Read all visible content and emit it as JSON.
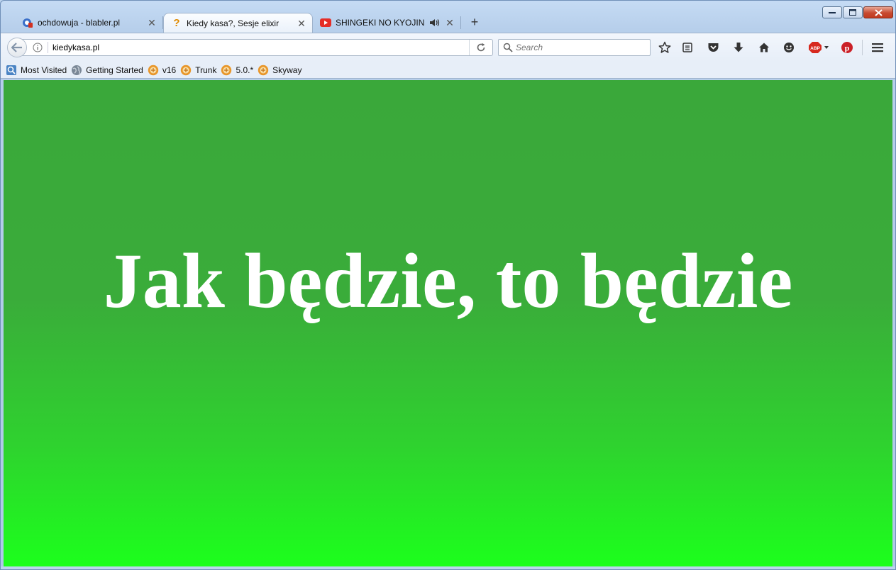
{
  "browser": {
    "tabs": [
      {
        "title": "ochdowuja - blabler.pl",
        "icon": "blabler-icon",
        "active": false
      },
      {
        "title": "Kiedy kasa?, Sesje elixir",
        "icon": "question-icon",
        "active": true
      },
      {
        "title": "SHINGEKI NO KYOJIN _...",
        "icon": "youtube-icon",
        "active": false,
        "audio": true
      }
    ],
    "new_tab_label": "+",
    "url": "kiedykasa.pl",
    "search_placeholder": "Search",
    "bookmarks": [
      {
        "label": "Most Visited",
        "icon": "most-visited-icon"
      },
      {
        "label": "Getting Started",
        "icon": "globe-icon"
      },
      {
        "label": "v16",
        "icon": "folder-badge-icon"
      },
      {
        "label": "Trunk",
        "icon": "folder-badge-icon"
      },
      {
        "label": "5.0.*",
        "icon": "folder-badge-icon"
      },
      {
        "label": "Skyway",
        "icon": "folder-badge-icon"
      }
    ],
    "toolbar_icons": [
      "star-icon",
      "reading-list-icon",
      "pocket-icon",
      "download-icon",
      "home-icon",
      "smiley-icon",
      "adblock-icon",
      "pinterest-icon",
      "menu-icon"
    ],
    "adblock_label": "ABP",
    "colors": {
      "content_top": "#3aa83a",
      "content_bottom": "#1cff1c",
      "close_button": "#c23a1f"
    }
  },
  "page": {
    "headline": "Jak będzie, to będzie"
  }
}
